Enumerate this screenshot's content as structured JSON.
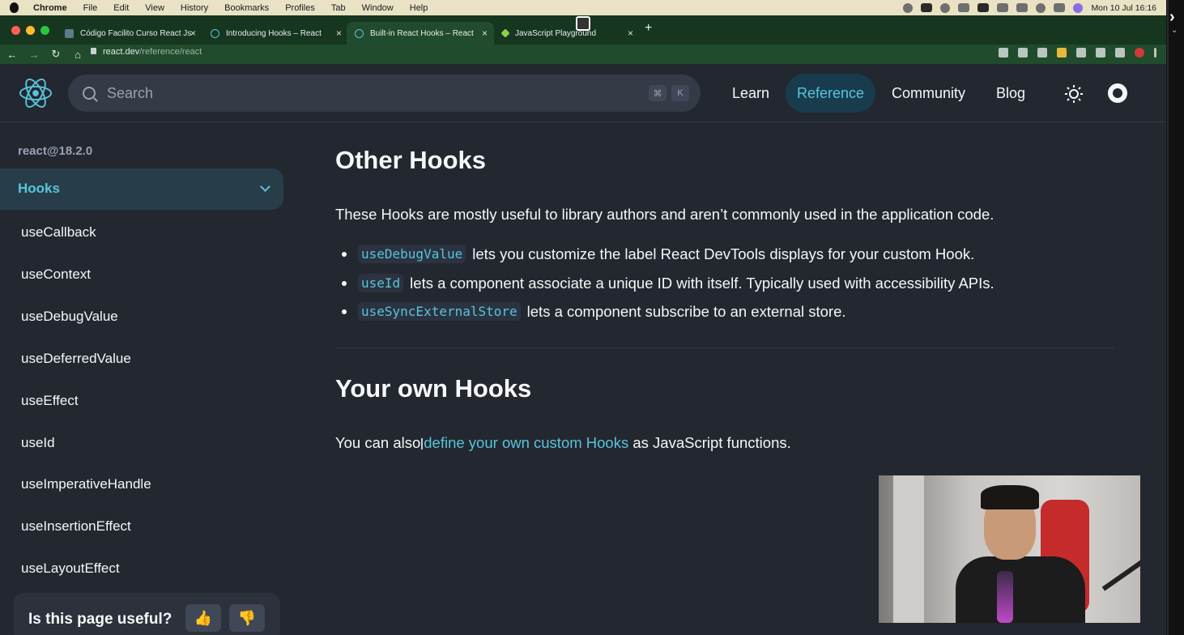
{
  "menubar": {
    "items": [
      "Chrome",
      "File",
      "Edit",
      "View",
      "History",
      "Bookmarks",
      "Profiles",
      "Tab",
      "Window",
      "Help"
    ],
    "clock": "Mon 10 Jul  16:16"
  },
  "tabs": [
    {
      "title": "Código Facilito Curso React Js",
      "active": false
    },
    {
      "title": "Introducing Hooks – React",
      "active": false
    },
    {
      "title": "Built-in React Hooks – React",
      "active": true
    },
    {
      "title": "JavaScript Playground",
      "active": false
    }
  ],
  "address": {
    "domain": "react.dev",
    "path": "/reference/react"
  },
  "site": {
    "search_placeholder": "Search",
    "kbd1": "⌘",
    "kbd2": "K",
    "nav": [
      "Learn",
      "Reference",
      "Community",
      "Blog"
    ],
    "active_nav": "Reference"
  },
  "sidebar": {
    "version": "react@18.2.0",
    "section": "Hooks",
    "items": [
      "useCallback",
      "useContext",
      "useDebugValue",
      "useDeferredValue",
      "useEffect",
      "useId",
      "useImperativeHandle",
      "useInsertionEffect",
      "useLayoutEffect"
    ],
    "feedback_question": "Is this page useful?"
  },
  "content": {
    "other_heading": "Other Hooks",
    "other_intro": "These Hooks are mostly useful to library authors and aren’t commonly used in the application code.",
    "list": [
      {
        "code": "useDebugValue",
        "text": "lets you customize the label React DevTools displays for your custom Hook."
      },
      {
        "code": "useId",
        "text": "lets a component associate a unique ID with itself. Typically used with accessibility APIs."
      },
      {
        "code": "useSyncExternalStore",
        "text": "lets a component subscribe to an external store."
      }
    ],
    "own_heading": "Your own Hooks",
    "own_prefix": "You can also",
    "own_link": "define your own custom Hooks",
    "own_suffix": "as JavaScript functions."
  },
  "colors": {
    "accent": "#58c4dc",
    "background": "#23272f",
    "chrome_frame": "#204b2c"
  }
}
